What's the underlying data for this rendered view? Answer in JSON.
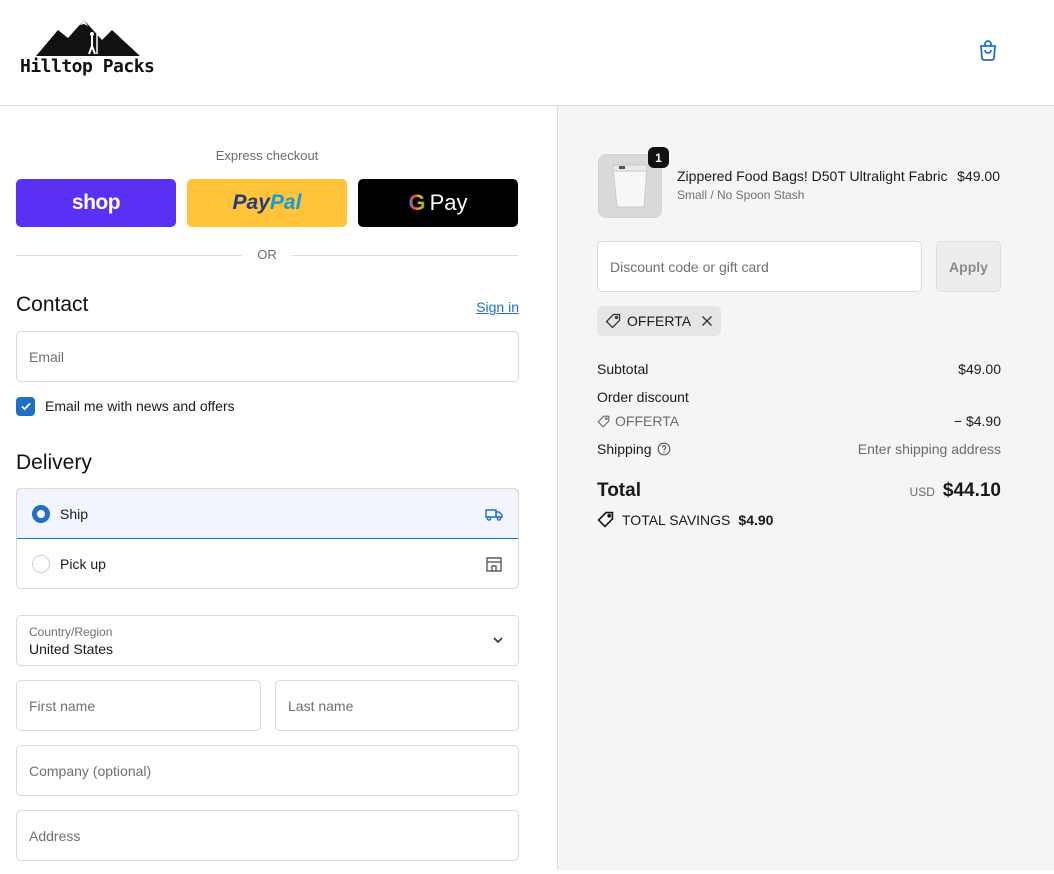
{
  "brand": {
    "name": "Hilltop Packs"
  },
  "express": {
    "label": "Express checkout",
    "shop_label": "shop",
    "paypal_part1": "Pay",
    "paypal_part2": "Pal",
    "gpay_g": "G",
    "gpay_label": "Pay",
    "or_label": "OR"
  },
  "contact": {
    "title": "Contact",
    "signin_label": "Sign in",
    "email_placeholder": "Email",
    "news_label": "Email me with news and offers",
    "news_checked": true
  },
  "delivery": {
    "title": "Delivery",
    "options": [
      {
        "label": "Ship",
        "selected": true
      },
      {
        "label": "Pick up",
        "selected": false
      }
    ],
    "country_label": "Country/Region",
    "country_value": "United States",
    "first_name_placeholder": "First name",
    "last_name_placeholder": "Last name",
    "company_placeholder": "Company (optional)",
    "address_placeholder": "Address"
  },
  "order": {
    "item": {
      "name": "Zippered Food Bags! D50T Ultralight Fabric",
      "variant": "Small / No Spoon Stash",
      "price": "$49.00",
      "quantity": "1"
    },
    "discount_placeholder": "Discount code or gift card",
    "apply_label": "Apply",
    "applied_code": "OFFERTA",
    "subtotal_label": "Subtotal",
    "subtotal_value": "$49.00",
    "order_discount_label": "Order discount",
    "discount_code": "OFFERTA",
    "discount_value": "− $4.90",
    "shipping_label": "Shipping",
    "shipping_value": "Enter shipping address",
    "total_label": "Total",
    "currency": "USD",
    "total_value": "$44.10",
    "savings_label": "TOTAL SAVINGS",
    "savings_value": "$4.90"
  },
  "colors": {
    "accent": "#1f6fc5",
    "shop_pay": "#5a31f4",
    "paypal": "#ffc439",
    "gpay": "#000000",
    "summary_bg": "#f5f5f5"
  }
}
